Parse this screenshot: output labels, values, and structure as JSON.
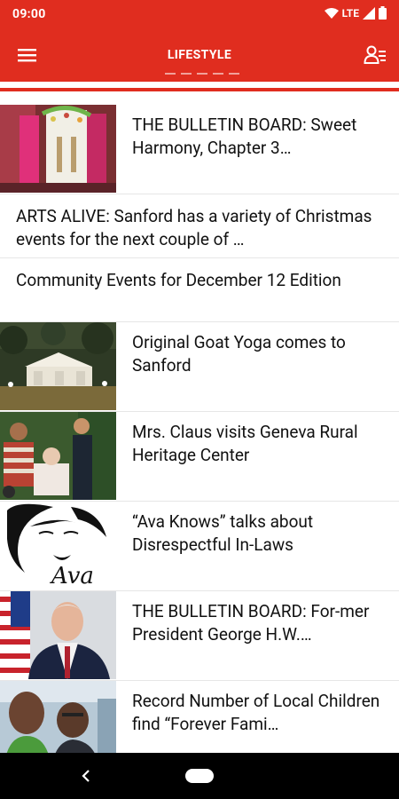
{
  "status_bar": {
    "time": "09:00",
    "network": "LTE"
  },
  "app_bar": {
    "title": "LIFESTYLE"
  },
  "articles": [
    {
      "title": "THE BULLETIN BOARD: Sweet Harmony, Chapter 3…",
      "has_image": true
    },
    {
      "title": "ARTS ALIVE: Sanford has a variety of Christmas events for the next couple of …",
      "has_image": false
    },
    {
      "title": "Community Events for December 12 Edition",
      "has_image": false
    },
    {
      "title": "Original Goat Yoga comes to Sanford",
      "has_image": true
    },
    {
      "title": "Mrs. Claus visits Geneva Rural Heritage Center",
      "has_image": true
    },
    {
      "title": "“Ava Knows” talks about Disrespectful In-Laws",
      "has_image": true
    },
    {
      "title": "THE BULLETIN BOARD: For-mer President George H.W.…",
      "has_image": true
    },
    {
      "title": "Record Number of Local Children find “Forever Fami…",
      "has_image": true
    }
  ],
  "thumbnails": {
    "ava_logo_text": "Ava"
  },
  "colors": {
    "brand_red": "#e02d1f",
    "nav_bar": "#000000"
  }
}
